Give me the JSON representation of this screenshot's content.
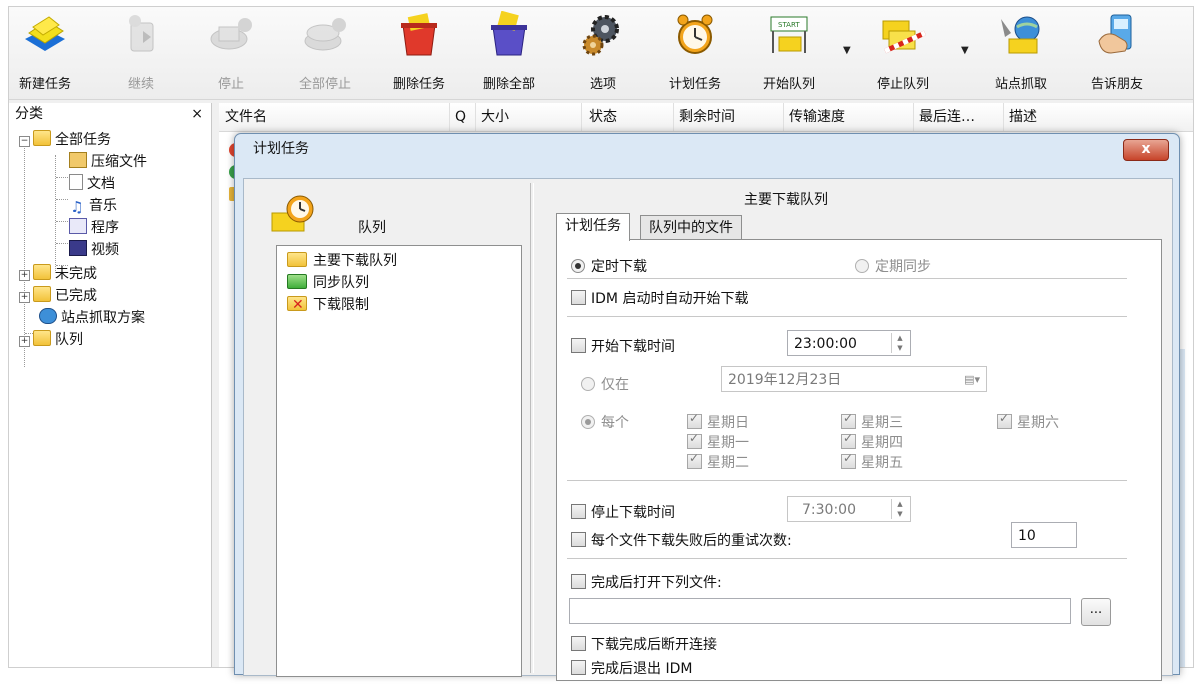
{
  "toolbar": {
    "new_task": "新建任务",
    "resume": "继续",
    "stop": "停止",
    "stop_all": "全部停止",
    "delete_task": "删除任务",
    "delete_all": "删除全部",
    "options": "选项",
    "scheduler": "计划任务",
    "start_queue": "开始队列",
    "stop_queue": "停止队列",
    "grabber": "站点抓取",
    "tell_friend": "告诉朋友"
  },
  "sidebar": {
    "title": "分类",
    "close": "×",
    "items": {
      "all": "全部任务",
      "compressed": "压缩文件",
      "documents": "文档",
      "music": "音乐",
      "programs": "程序",
      "video": "视频",
      "unfinished": "未完成",
      "finished": "已完成",
      "grabber_projects": "站点抓取方案",
      "queues": "队列"
    }
  },
  "list_header": {
    "filename": "文件名",
    "q": "Q",
    "size": "大小",
    "status": "状态",
    "time_left": "剩余时间",
    "speed": "传输速度",
    "last_try": "最后连…",
    "description": "描述"
  },
  "dialog": {
    "title": "计划任务",
    "close": "x",
    "queues_caption": "队列",
    "queues": [
      "主要下载队列",
      "同步队列",
      "下载限制"
    ],
    "queue_title": "主要下载队列",
    "tabs": [
      "计划任务",
      "队列中的文件"
    ],
    "one_time": "定时下载",
    "periodic_sync": "定期同步",
    "start_on_idm": "IDM 启动时自动开始下载",
    "start_download_at": "开始下载时间",
    "start_time_value": "23:00:00",
    "once": "仅在",
    "once_date": "2019年12月23日",
    "daily": "每个",
    "days": {
      "sun": "星期日",
      "mon": "星期一",
      "tue": "星期二",
      "wed": "星期三",
      "thu": "星期四",
      "fri": "星期五",
      "sat": "星期六"
    },
    "stop_download_at": "停止下载时间",
    "stop_time_value": "7:30:00",
    "retry_label": "每个文件下载失败后的重试次数:",
    "retry_value": "10",
    "open_file_label": "完成后打开下列文件:",
    "browse": "...",
    "hangup": "下载完成后断开连接",
    "exit_idm": "完成后退出 IDM"
  }
}
